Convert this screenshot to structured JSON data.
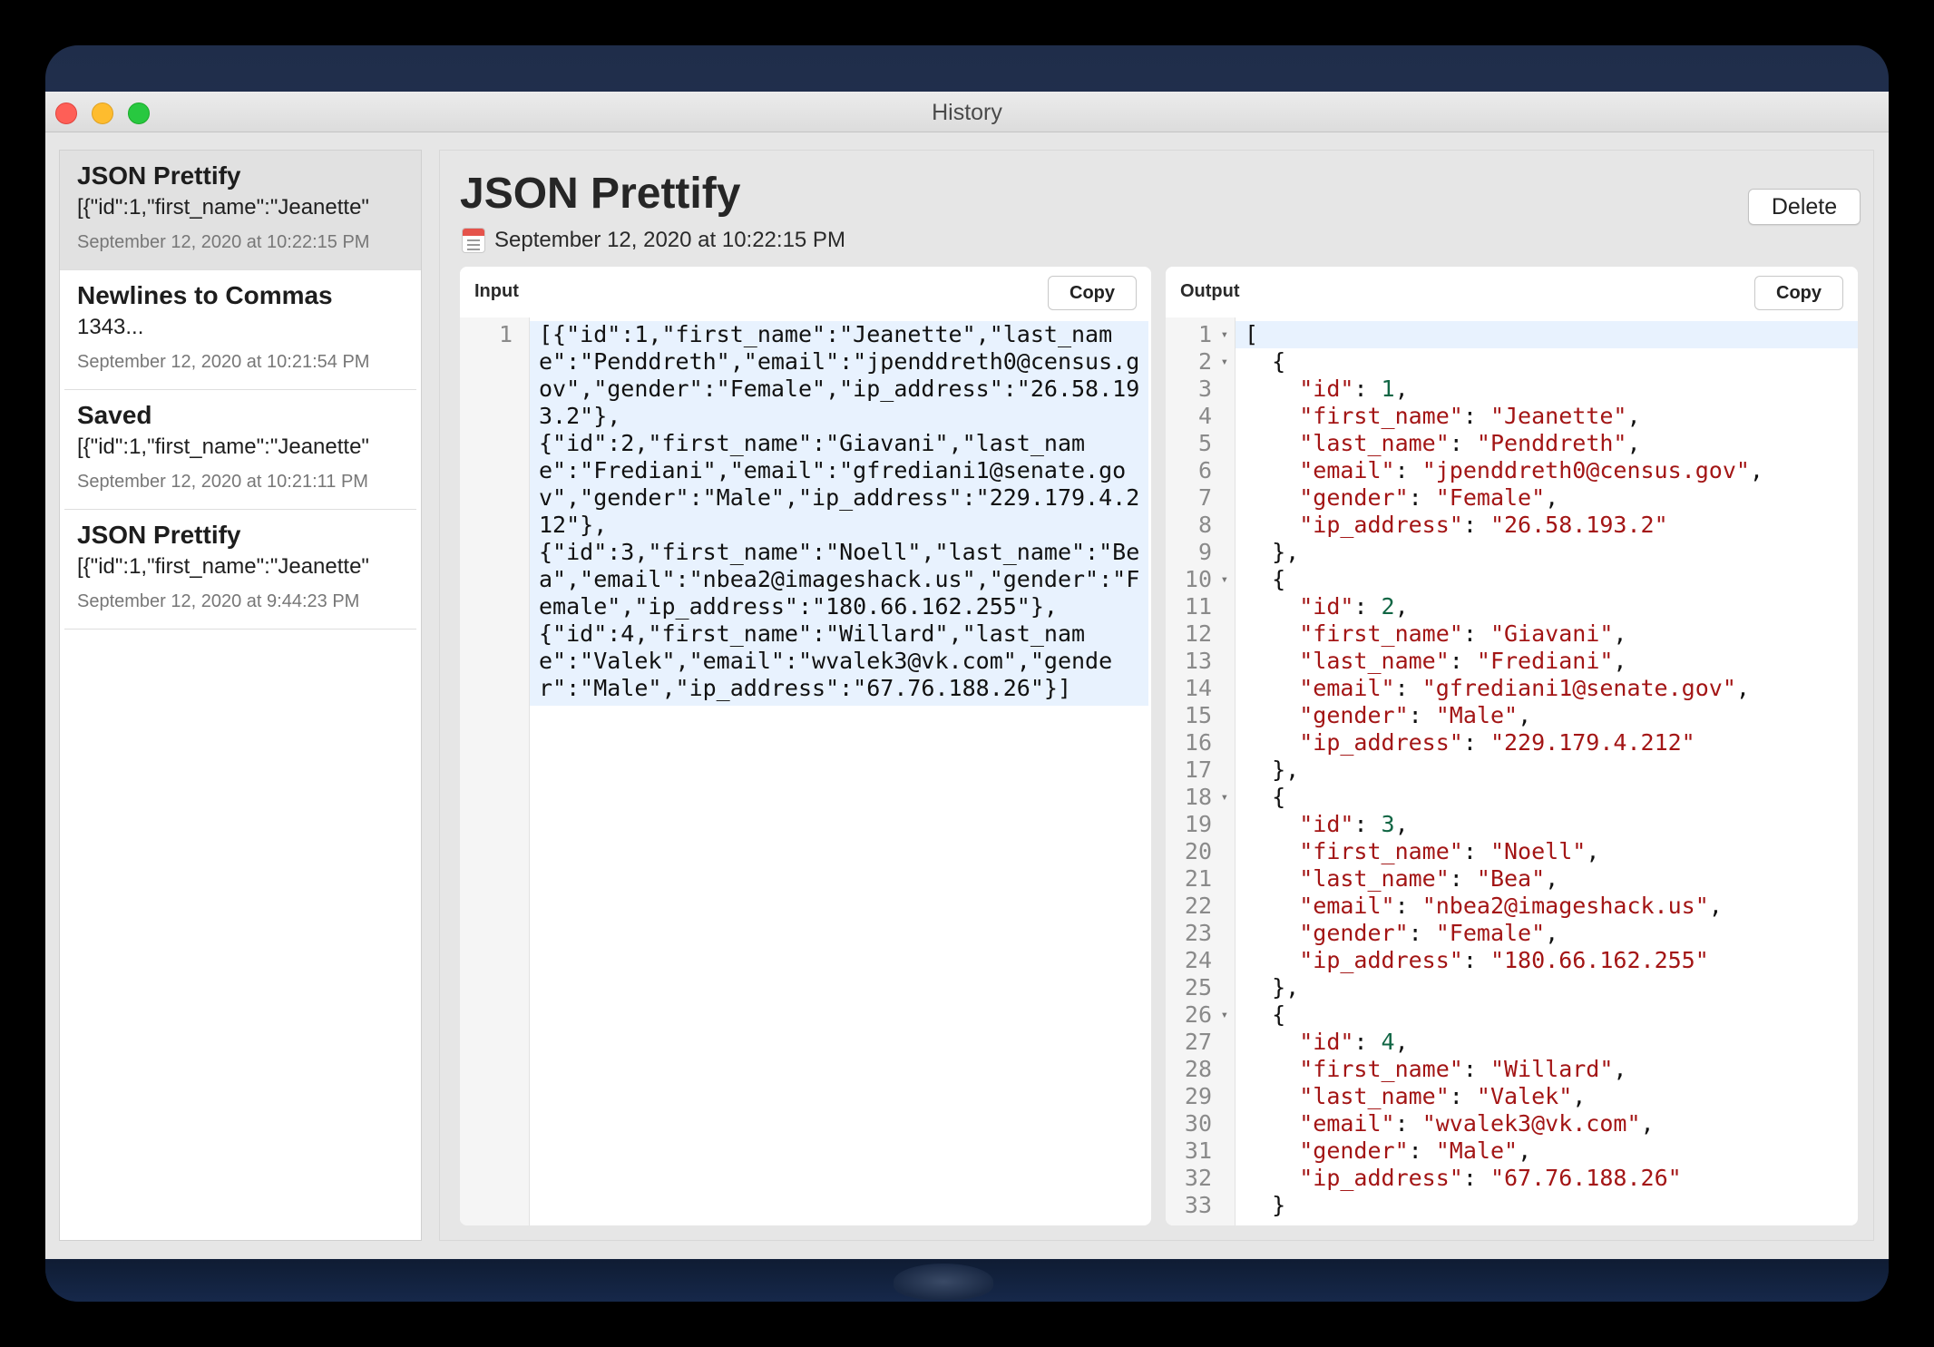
{
  "window": {
    "title": "History"
  },
  "sidebar": {
    "items": [
      {
        "title": "JSON Prettify",
        "snippet": "[{\"id\":1,\"first_name\":\"Jeanette\"",
        "date": "September 12, 2020 at 10:22:15 PM",
        "selected": true
      },
      {
        "title": "Newlines to Commas",
        "snippet": "1343...",
        "date": "September 12, 2020 at 10:21:54 PM",
        "selected": false
      },
      {
        "title": "Saved",
        "snippet": "[{\"id\":1,\"first_name\":\"Jeanette\"",
        "date": "September 12, 2020 at 10:21:11 PM",
        "selected": false
      },
      {
        "title": "JSON Prettify",
        "snippet": "[{\"id\":1,\"first_name\":\"Jeanette\"",
        "date": "September 12, 2020 at 9:44:23 PM",
        "selected": false
      }
    ]
  },
  "detail": {
    "title": "JSON Prettify",
    "date": "September 12, 2020 at 10:22:15 PM",
    "delete_label": "Delete",
    "calendar_icon": "calendar-icon"
  },
  "input_panel": {
    "label": "Input",
    "copy_label": "Copy",
    "line_number": "1",
    "text": "[{\"id\":1,\"first_name\":\"Jeanette\",\"last_name\":\"Penddreth\",\"email\":\"jpenddreth0@census.gov\",\"gender\":\"Female\",\"ip_address\":\"26.58.193.2\"},\n{\"id\":2,\"first_name\":\"Giavani\",\"last_name\":\"Frediani\",\"email\":\"gfrediani1@senate.gov\",\"gender\":\"Male\",\"ip_address\":\"229.179.4.212\"},\n{\"id\":3,\"first_name\":\"Noell\",\"last_name\":\"Bea\",\"email\":\"nbea2@imageshack.us\",\"gender\":\"Female\",\"ip_address\":\"180.66.162.255\"},\n{\"id\":4,\"first_name\":\"Willard\",\"last_name\":\"Valek\",\"email\":\"wvalek3@vk.com\",\"gender\":\"Male\",\"ip_address\":\"67.76.188.26\"}]"
  },
  "output_panel": {
    "label": "Output",
    "copy_label": "Copy",
    "fold_lines": [
      1,
      2,
      10,
      18,
      26
    ],
    "records": [
      {
        "id": "1",
        "first_name": "Jeanette",
        "last_name": "Penddreth",
        "email": "jpenddreth0@census.gov",
        "gender": "Female",
        "ip_address": "26.58.193.2"
      },
      {
        "id": "2",
        "first_name": "Giavani",
        "last_name": "Frediani",
        "email": "gfrediani1@senate.gov",
        "gender": "Male",
        "ip_address": "229.179.4.212"
      },
      {
        "id": "3",
        "first_name": "Noell",
        "last_name": "Bea",
        "email": "nbea2@imageshack.us",
        "gender": "Female",
        "ip_address": "180.66.162.255"
      },
      {
        "id": "4",
        "first_name": "Willard",
        "last_name": "Valek",
        "email": "wvalek3@vk.com",
        "gender": "Male",
        "ip_address": "67.76.188.26"
      }
    ]
  }
}
